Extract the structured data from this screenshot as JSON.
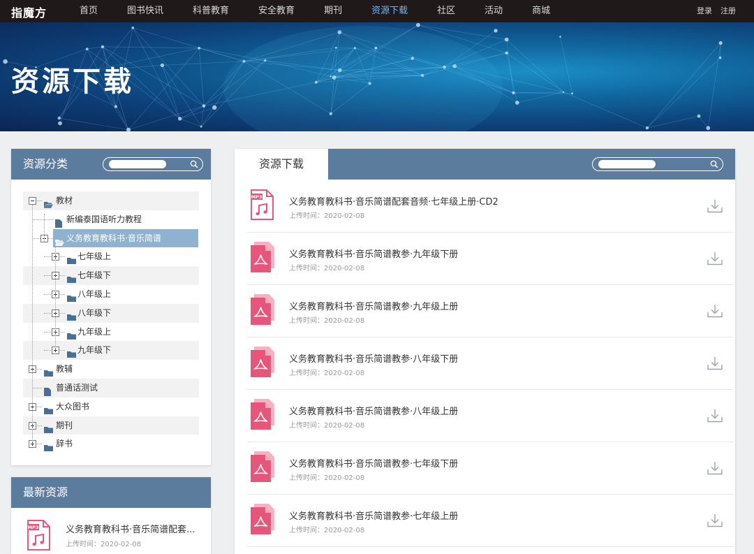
{
  "nav": {
    "logo": "指魔方",
    "items": [
      {
        "label": "首页",
        "active": false
      },
      {
        "label": "图书快讯",
        "active": false
      },
      {
        "label": "科普教育",
        "active": false
      },
      {
        "label": "安全教育",
        "active": false
      },
      {
        "label": "期刊",
        "active": false
      },
      {
        "label": "资源下载",
        "active": true
      },
      {
        "label": "社区",
        "active": false
      },
      {
        "label": "活动",
        "active": false
      },
      {
        "label": "商城",
        "active": false
      }
    ],
    "login": "登录",
    "register": "注册"
  },
  "banner": {
    "title": "资源下载"
  },
  "categories": {
    "title": "资源分类",
    "tree": [
      {
        "label": "教材",
        "depth": 0,
        "type": "folder-open",
        "toggle": "minus",
        "band": true
      },
      {
        "label": "新编泰国语听力教程",
        "depth": 1,
        "type": "file",
        "toggle": "none",
        "band": false
      },
      {
        "label": "义务教育教科书·音乐简谱",
        "depth": 1,
        "type": "folder-open",
        "toggle": "minus",
        "band": false,
        "selected": true
      },
      {
        "label": "七年级上",
        "depth": 2,
        "type": "folder",
        "toggle": "plus",
        "band": false
      },
      {
        "label": "七年级下",
        "depth": 2,
        "type": "folder",
        "toggle": "plus",
        "band": true
      },
      {
        "label": "八年级上",
        "depth": 2,
        "type": "folder",
        "toggle": "plus",
        "band": false
      },
      {
        "label": "八年级下",
        "depth": 2,
        "type": "folder",
        "toggle": "plus",
        "band": true
      },
      {
        "label": "九年级上",
        "depth": 2,
        "type": "folder",
        "toggle": "plus",
        "band": false
      },
      {
        "label": "九年级下",
        "depth": 2,
        "type": "folder",
        "toggle": "plus",
        "band": true
      },
      {
        "label": "教辅",
        "depth": 0,
        "type": "folder",
        "toggle": "plus",
        "band": false
      },
      {
        "label": "普通话测试",
        "depth": 0,
        "type": "file",
        "toggle": "none",
        "band": true
      },
      {
        "label": "大众图书",
        "depth": 0,
        "type": "folder",
        "toggle": "plus",
        "band": false
      },
      {
        "label": "期刊",
        "depth": 0,
        "type": "folder",
        "toggle": "plus",
        "band": true
      },
      {
        "label": "辞书",
        "depth": 0,
        "type": "folder",
        "toggle": "plus",
        "band": false
      }
    ]
  },
  "latest": {
    "title": "最新资源",
    "items": [
      {
        "title": "义务教育教科书·音乐简谱配套...",
        "date_label": "上传时间：2020-02-08",
        "file_type": "MP3"
      }
    ]
  },
  "downloads": {
    "tab_label": "资源下载",
    "items": [
      {
        "title": "义务教育教科书·音乐简谱配套音频·七年级上册·CD2",
        "date_label": "上传时间：2020-02-08",
        "file_type": "MP3"
      },
      {
        "title": "义务教育教科书·音乐简谱教参·九年级下册",
        "date_label": "上传时间：2020-02-08",
        "file_type": "pdf"
      },
      {
        "title": "义务教育教科书·音乐简谱教参·九年级上册",
        "date_label": "上传时间：2020-02-08",
        "file_type": "pdf"
      },
      {
        "title": "义务教育教科书·音乐简谱教参·八年级下册",
        "date_label": "上传时间：2020-02-08",
        "file_type": "pdf"
      },
      {
        "title": "义务教育教科书·音乐简谱教参·八年级上册",
        "date_label": "上传时间：2020-02-08",
        "file_type": "pdf"
      },
      {
        "title": "义务教育教科书·音乐简谱教参·七年级下册",
        "date_label": "上传时间：2020-02-08",
        "file_type": "pdf"
      },
      {
        "title": "义务教育教科书·音乐简谱教参·七年级上册",
        "date_label": "上传时间：2020-02-08",
        "file_type": "pdf"
      }
    ]
  },
  "colors": {
    "nav_bg": "#1f1a19",
    "active_nav": "#6fb6ff",
    "panel_header": "#5c7c9e",
    "selected_tree": "#8eb2cf",
    "file_icon": "#e8557b"
  }
}
